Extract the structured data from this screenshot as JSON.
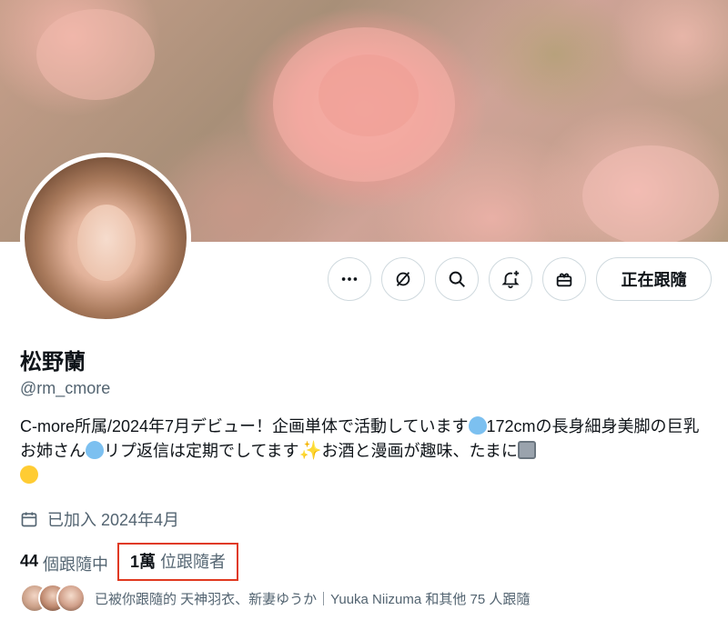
{
  "profile": {
    "display_name": "松野蘭",
    "handle": "@rm_cmore",
    "bio_part1": "C-more所属/2024年7月デビュー！企画単体で活動しています",
    "bio_part2": "172cmの長身細身美脚の巨乳お姉さん",
    "bio_part3": "リプ返信は定期でしてます",
    "bio_part4": "お酒と漫画が趣味、たまに",
    "joined": "已加入 2024年4月"
  },
  "actions": {
    "more_icon": "more-horizontal-icon",
    "grok_icon": "grok-slash-icon",
    "search_icon": "search-icon",
    "notify_icon": "bell-plus-icon",
    "gift_icon": "gift-icon",
    "follow_label": "正在跟隨"
  },
  "stats": {
    "following_count": "44",
    "following_label": "個跟隨中",
    "followers_count": "1萬",
    "followers_label": "位跟隨者"
  },
  "followed_by": {
    "text": "已被你跟隨的 天神羽衣、新妻ゆうか｜Yuuka Niizuma 和其他 75 人跟隨"
  },
  "colors": {
    "highlight_border": "#e0391f",
    "secondary_text": "#536471",
    "primary_text": "#0f1419"
  }
}
